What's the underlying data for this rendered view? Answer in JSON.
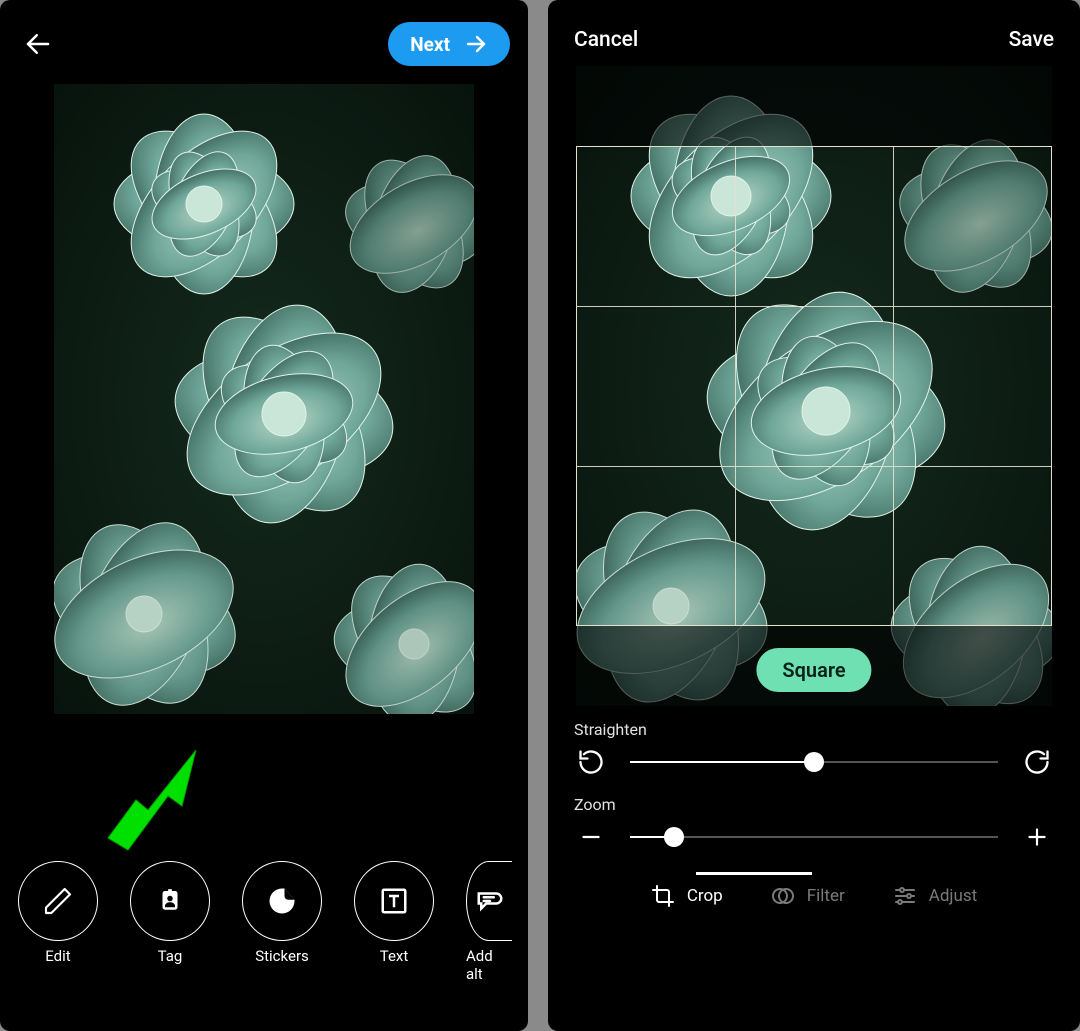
{
  "left": {
    "header": {
      "back_icon": "arrow-left",
      "next_label": "Next",
      "next_icon": "arrow-right"
    },
    "tools": [
      {
        "id": "edit",
        "label": "Edit",
        "icon": "pencil-icon"
      },
      {
        "id": "tag",
        "label": "Tag",
        "icon": "tag-person-icon"
      },
      {
        "id": "stickers",
        "label": "Stickers",
        "icon": "sticker-icon"
      },
      {
        "id": "text",
        "label": "Text",
        "icon": "text-icon"
      },
      {
        "id": "addalt",
        "label": "Add alt",
        "icon": "alt-text-icon",
        "partial": true
      }
    ],
    "annotation": {
      "type": "arrow",
      "color": "#00ff00",
      "points_to": "edit"
    }
  },
  "right": {
    "header": {
      "cancel_label": "Cancel",
      "save_label": "Save"
    },
    "aspect_pill": {
      "label": "Square",
      "active": true
    },
    "crop": {
      "grid": "rule-of-thirds"
    },
    "straighten": {
      "label": "Straighten",
      "value_pct": 50,
      "left_icon": "rotate-ccw-icon",
      "right_icon": "rotate-cw-icon"
    },
    "zoom": {
      "label": "Zoom",
      "value_pct": 12,
      "left_icon": "minus-icon",
      "right_icon": "plus-icon"
    },
    "tabs": [
      {
        "id": "crop",
        "label": "Crop",
        "icon": "crop-icon",
        "active": true
      },
      {
        "id": "filter",
        "label": "Filter",
        "icon": "filter-icon",
        "active": false
      },
      {
        "id": "adjust",
        "label": "Adjust",
        "icon": "sliders-icon",
        "active": false
      }
    ]
  },
  "colors": {
    "accent_blue": "#1d9bf0",
    "accent_green": "#6fe0b2",
    "annotation_green": "#00ff00"
  }
}
